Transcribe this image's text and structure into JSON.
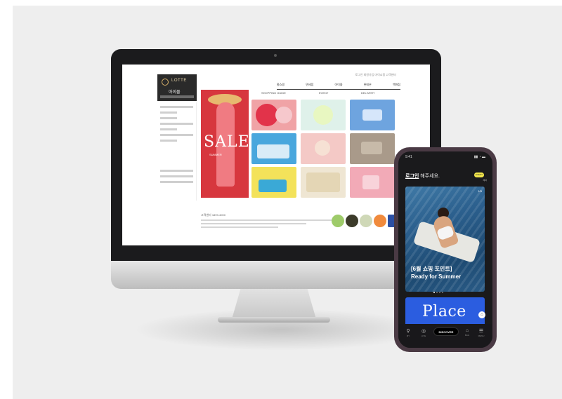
{
  "desktop": {
    "logo_text": "LOTTE",
    "logo_sub": "아이몰",
    "top_util": "로그인  회원가입  마이쇼핑  고객센터",
    "nav": [
      "홈쇼핑",
      "면세점",
      "아이몰",
      "롯데온",
      "백화점"
    ],
    "grid_labels": [
      "SHOPPING GUIDE",
      "EVENT",
      "DELIVERY"
    ],
    "sale_text": "SALE",
    "sale_sub": "SUMMER",
    "footer": "고객센터 1899-4000"
  },
  "phone": {
    "status_time": "9:41",
    "status_icons": "▮▮ ◔ ▬",
    "login_link": "로그인",
    "login_rest": " 해주세요.",
    "pill": "EVENT",
    "pill_sub": "혜택",
    "hero_counter": "1/5",
    "caption_line1": "[6월 쇼핑 포인트]",
    "caption_line2": "Ready for Summer",
    "place_title": "Place",
    "fab": "⌂",
    "tabs": [
      {
        "icon": "⚲",
        "label": "MY"
      },
      {
        "icon": "◎",
        "label": "LIVE"
      },
      {
        "icon": "DISCOVER"
      },
      {
        "icon": "⌂",
        "label": "BAG"
      },
      {
        "icon": "☰",
        "label": "MENU"
      }
    ]
  }
}
